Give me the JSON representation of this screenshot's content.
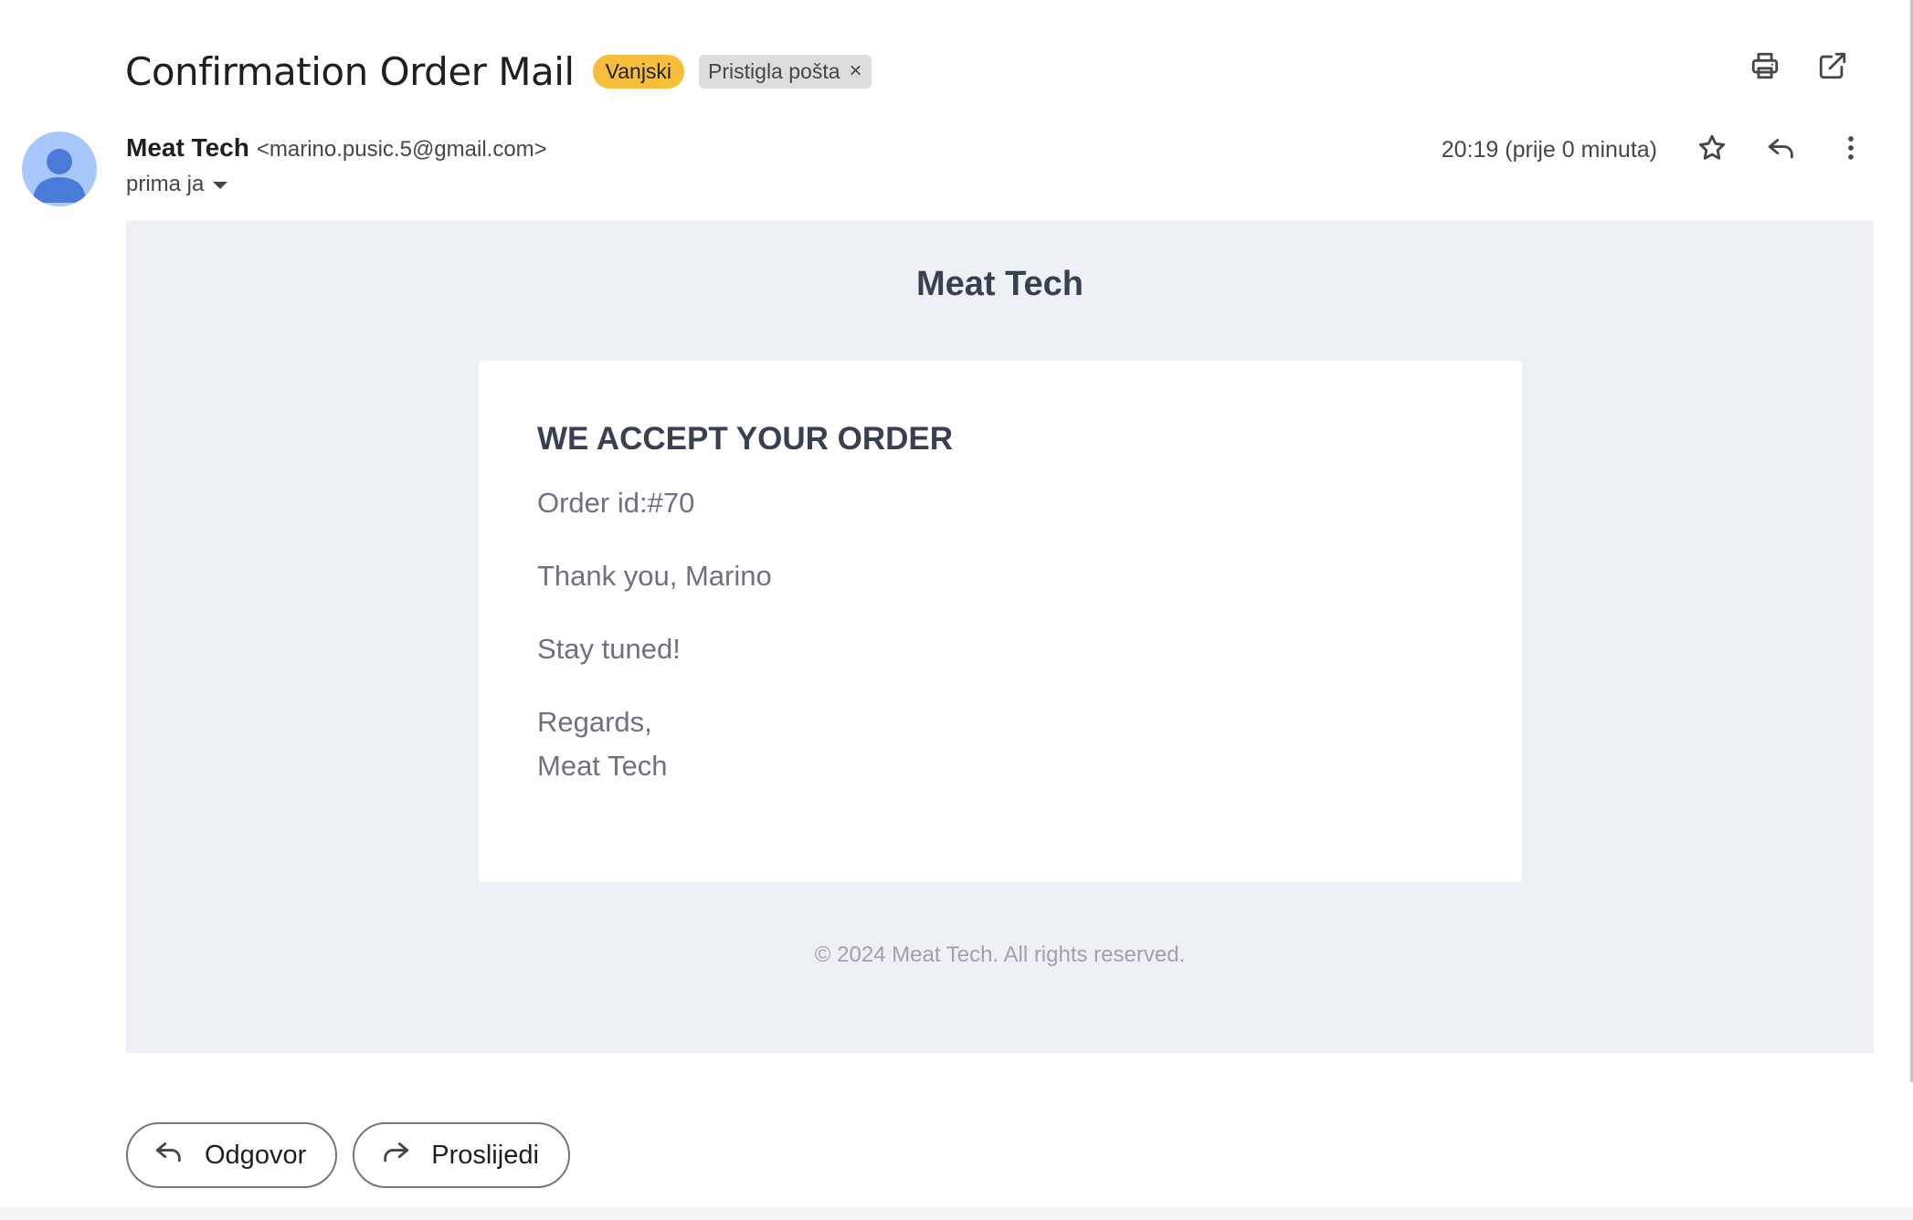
{
  "message": {
    "subject": "Confirmation Order Mail",
    "labels": {
      "external": "Vanjski",
      "inbox": "Pristigla pošta",
      "inbox_remove": "×"
    },
    "sender": {
      "name": "Meat Tech",
      "email": "<marino.pusic.5@gmail.com>"
    },
    "recipient_summary": "prima ja",
    "timestamp": "20:19 (prije 0 minuta)"
  },
  "toolbar_icons": [
    "print-icon",
    "open-in-new-window-icon"
  ],
  "message_icons": [
    "star-icon",
    "reply-icon",
    "more-vert-icon"
  ],
  "email_content": {
    "brand": "Meat Tech",
    "heading": "WE ACCEPT YOUR ORDER",
    "order_id": "Order id:#70",
    "thanks": "Thank you, Marino",
    "stay_tuned": "Stay tuned!",
    "regards": "Regards,",
    "signature": "Meat Tech",
    "footer": "© 2024 Meat Tech. All rights reserved."
  },
  "actions": {
    "reply": "Odgovor",
    "forward": "Proslijedi"
  },
  "colors": {
    "external_label": "#f6be3b",
    "inbox_label": "#dddddd",
    "avatar_bg": "#a8c7fa",
    "avatar_fg": "#4b7bd8",
    "email_bg": "#edf1f6",
    "heading_text": "#374151",
    "body_text": "#6b7280",
    "footer_text": "#9ca3af"
  }
}
